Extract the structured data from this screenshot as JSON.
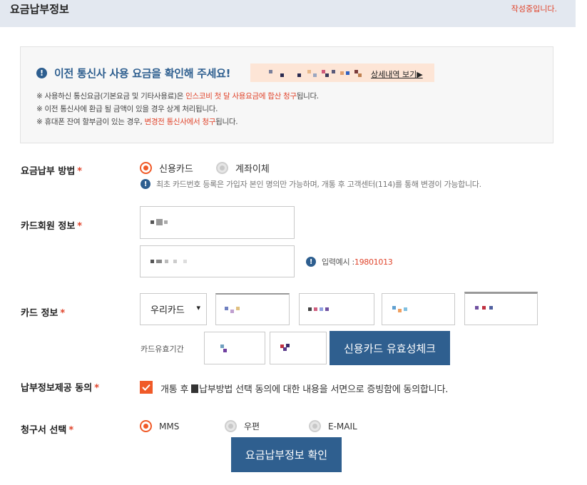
{
  "header": {
    "title": "요금납부정보",
    "status": "작성중입니다."
  },
  "notice": {
    "heading": "이전 통신사 사용 요금을 확인해 주세요!",
    "detail_link": "상세내역 보기▶",
    "line1_a": "※ 사용하신 통신요금(기본요금 및 기타사용료)은 ",
    "line1_b": "인스코비 첫 달 사용요금에 합산 청구",
    "line1_c": "됩니다.",
    "line2": "※ 이전 통신사에 환급 될 금액이 있을 경우 상계 처리됩니다.",
    "line3_a": "※ 휴대폰 잔여 할부금이 있는 경우, ",
    "line3_b": "변경전 통신사에서 청구",
    "line3_c": "됩니다."
  },
  "payment_method": {
    "label": "요금납부 방법",
    "options": [
      "신용카드",
      "계좌이체"
    ],
    "selected": "신용카드",
    "hint": "최초 카드번호 등록은 가입자 본인 명의만 가능하며, 개통 후 고객센터(114)를 통해 변경이 가능합니다."
  },
  "card_member": {
    "label": "카드회원 정보",
    "example_label": "입력예시 : ",
    "example_value": "19801013"
  },
  "card_info": {
    "label": "카드 정보",
    "card_select": "우리카드",
    "expiry_label": "카드유효기간",
    "validate_button": "신용카드 유효성체크"
  },
  "agreement": {
    "label": "납부정보제공 동의",
    "text_a": "개통 후 ",
    "text_b": "납부방법 선택 동의에 대한 내용을 서면으로 증빙함에 동의합니다.",
    "checked": true
  },
  "bill": {
    "label": "청구서 선택",
    "options": [
      "MMS",
      "우편",
      "E-MAIL"
    ],
    "selected": "MMS"
  },
  "confirm_button": "요금납부정보 확인",
  "required_mark": "*",
  "colors": {
    "accent": "#f05a28",
    "primary": "#2f5f8f",
    "header_bg": "#e3e8f0"
  }
}
